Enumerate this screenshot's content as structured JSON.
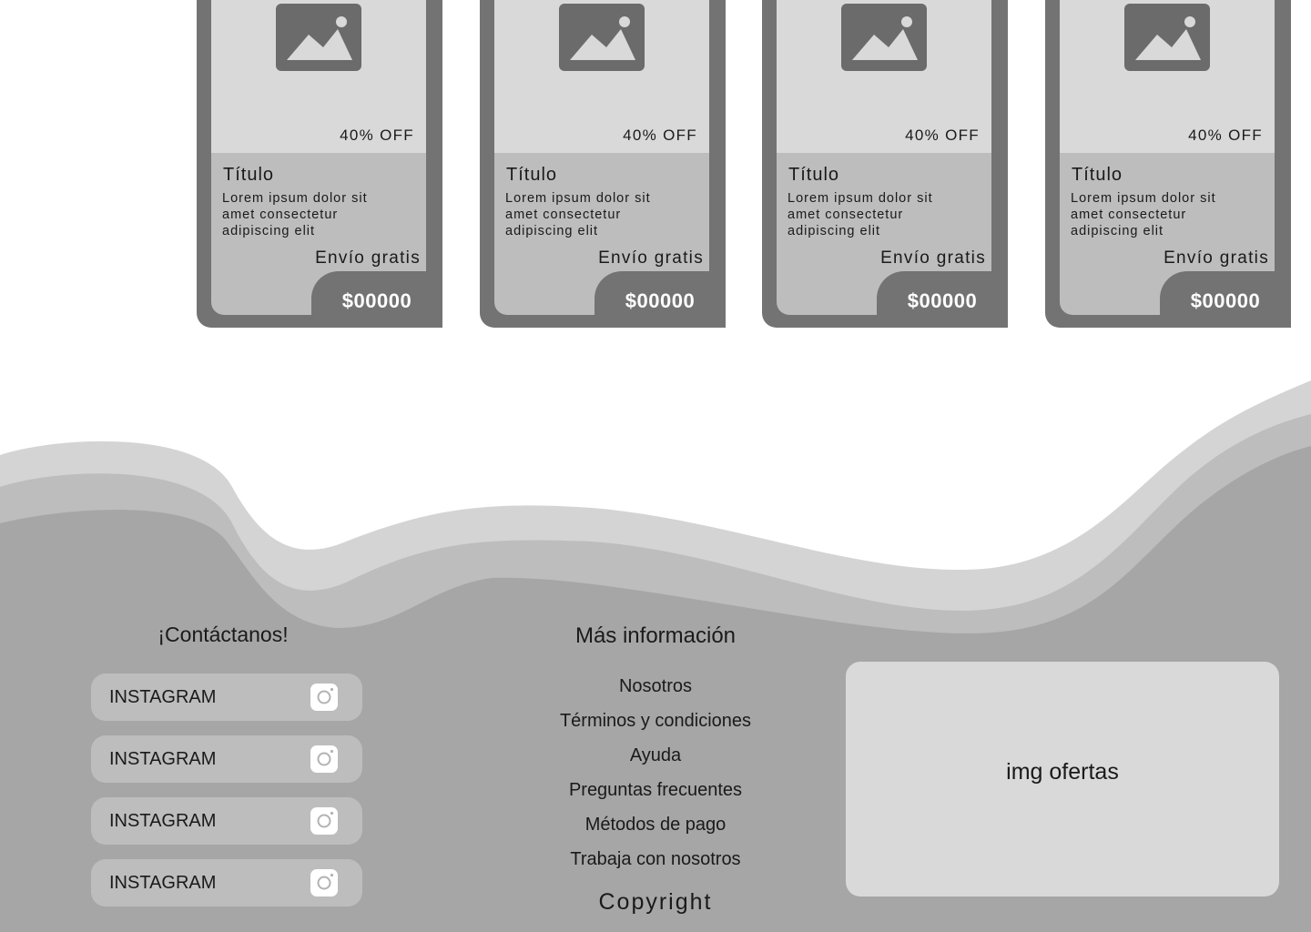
{
  "products": [
    {
      "discount": "40% OFF",
      "title": "Título",
      "description": "Lorem ipsum dolor sit amet consectetur adipiscing elit",
      "shipping": "Envío gratis",
      "price": "$00000",
      "image_icon": "image-placeholder-icon"
    },
    {
      "discount": "40% OFF",
      "title": "Título",
      "description": "Lorem ipsum dolor sit amet consectetur adipiscing elit",
      "shipping": "Envío gratis",
      "price": "$00000",
      "image_icon": "image-placeholder-icon"
    },
    {
      "discount": "40% OFF",
      "title": "Título",
      "description": "Lorem ipsum dolor sit amet consectetur adipiscing elit",
      "shipping": "Envío gratis",
      "price": "$00000",
      "image_icon": "image-placeholder-icon"
    },
    {
      "discount": "40% OFF",
      "title": "Título",
      "description": "Lorem ipsum dolor sit amet consectetur adipiscing elit",
      "shipping": "Envío gratis",
      "price": "$00000",
      "image_icon": "image-placeholder-icon"
    }
  ],
  "footer": {
    "contact": {
      "title": "¡Contáctanos!",
      "socials": [
        {
          "label": "INSTAGRAM",
          "icon": "instagram-icon"
        },
        {
          "label": "INSTAGRAM",
          "icon": "instagram-icon"
        },
        {
          "label": "INSTAGRAM",
          "icon": "instagram-icon"
        },
        {
          "label": "INSTAGRAM",
          "icon": "instagram-icon"
        }
      ]
    },
    "info": {
      "title": "Más información",
      "links": [
        "Nosotros",
        "Términos y condiciones",
        "Ayuda",
        "Preguntas frecuentes",
        "Métodos de pago",
        "Trabaja con nosotros"
      ],
      "copyright": "Copyright"
    },
    "offers": {
      "label": "img ofertas"
    }
  },
  "colors": {
    "card_frame": "#737373",
    "card_body": "#bdbdbd",
    "card_image": "#d9d9d9",
    "footer_bg": "#a6a6a6",
    "wave_light": "#d4d4d4",
    "wave_mid": "#bdbdbd",
    "price_text": "#ffffff"
  }
}
